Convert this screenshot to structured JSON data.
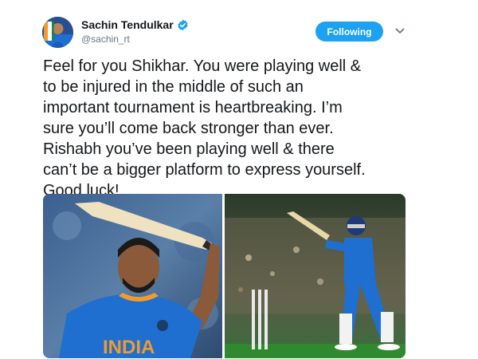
{
  "author": {
    "display_name": "Sachin Tendulkar",
    "handle": "@sachin_rt",
    "avatar_icon": "avatar-icon",
    "verified_icon": "verified-badge-icon"
  },
  "actions": {
    "follow_label": "Following",
    "menu_icon": "chevron-down-icon"
  },
  "tweet": {
    "text": "Feel for you Shikhar. You were playing well &\nto be injured in the middle of such an\nimportant tournament is heartbreaking. I’m\nsure you’ll come back stronger than ever.\nRishabh you’ve been playing well & there\ncan’t be a bigger platform to express yourself.\nGood luck!"
  },
  "media": {
    "left_jersey_text": "INDIA",
    "colors": {
      "accent": "#1da1f2",
      "jersey": "#1e6fd0",
      "field": "#2f8a2f"
    }
  }
}
